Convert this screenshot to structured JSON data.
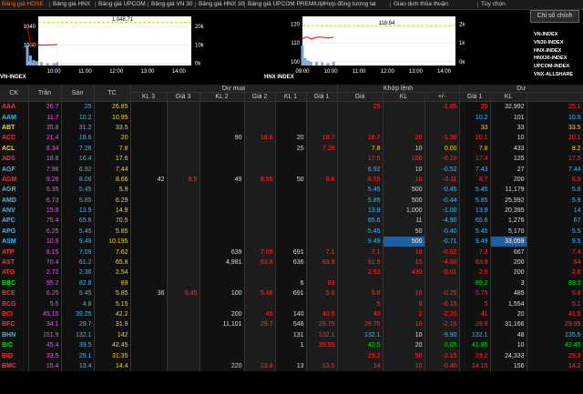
{
  "nav": [
    {
      "label": "Bảng giá HOSE",
      "active": true
    },
    {
      "label": "Bảng giá HNX",
      "active": false
    },
    {
      "label": "Bảng giá UPCOM",
      "active": false
    },
    {
      "label": "Bảng giá VN 30",
      "active": false
    },
    {
      "label": "Bảng giá HNX 30",
      "active": false
    },
    {
      "label": "Bảng giá UPCOM PREMIUM",
      "active": false
    },
    {
      "label": "Hợp đồng tương lai",
      "active": false
    },
    {
      "label": "Giao dịch thỏa thuận",
      "active": false
    },
    {
      "label": "Tùy chọn",
      "active": false
    }
  ],
  "select_button": "Chỉ số chính",
  "chart_data": [
    {
      "type": "line",
      "title": "VN-INDEX",
      "current_label": "1,048.71",
      "x_ticks": [
        "10:00",
        "11:00",
        "12:00",
        "13:00",
        "14:00"
      ],
      "y_left_ticks": [
        "1040",
        "1000",
        "960"
      ],
      "y_right_ticks": [
        "20k",
        "10k",
        "0k"
      ],
      "ylim": [
        955,
        1062
      ],
      "reference": 1048.71,
      "x": [
        9.15,
        9.25,
        9.35,
        9.45,
        9.6,
        9.8,
        10.0,
        10.1
      ],
      "y": [
        1040,
        1004,
        1000,
        1001,
        999,
        1000,
        1000,
        1001
      ],
      "volume": [
        18,
        9,
        5,
        4,
        3,
        2,
        2,
        3
      ]
    },
    {
      "type": "line",
      "title": "HNX INDEX",
      "current_label": "118.94",
      "x_ticks": [
        "09:00",
        "10:00",
        "11:00",
        "12:00",
        "13:00",
        "14:00"
      ],
      "y_left_ticks": [
        "120",
        "110",
        "100"
      ],
      "y_right_ticks": [
        "2k",
        "1k",
        "0k"
      ],
      "ylim": [
        98,
        124
      ],
      "reference": 118.94,
      "x": [
        9.0,
        9.1,
        9.2,
        9.3,
        9.5,
        9.7,
        9.9,
        10.1
      ],
      "y": [
        112,
        113,
        113,
        112,
        113,
        113,
        112.5,
        113
      ],
      "volume": [
        1.6,
        0.6,
        0.4,
        0.3,
        0.3,
        0.25,
        0.2,
        0.3
      ]
    }
  ],
  "index_list": [
    "VN-INDEX",
    "VN30-INDEX",
    "HNX-INDEX",
    "HNX30-INDEX",
    "UPCOM-INDEX",
    "VNX-ALLSHARE"
  ],
  "table": {
    "headers": {
      "ck": "CK",
      "tran": "Trần",
      "san": "Sàn",
      "tc": "TC",
      "du_mua": "Dư mua",
      "khop_lenh": "Khớp lệnh",
      "du_ban": "Dư",
      "kl3": "KL 3",
      "gia3": "Giá 3",
      "kl2": "KL 2",
      "gia2": "Giá 2",
      "kl1": "KL 1",
      "gia1": "Giá 1",
      "gia": "Giá",
      "kl": "KL",
      "change": "+/-",
      "ban_gia1": "Giá 1",
      "ban_kl1": "KL"
    },
    "rows": [
      {
        "ck": "AAA",
        "tran": "26.7",
        "san": "25",
        "tc": "26.85",
        "kl3": "",
        "gia3": "",
        "kl2": "",
        "gia2": "",
        "kl1": "",
        "gia1": "",
        "gia": "25",
        "kl": "",
        "chg": "-1.85",
        "bg1": "25",
        "bkl1": "32,992",
        "dg": "25.1",
        "c": "dn"
      },
      {
        "ck": "AAM",
        "tran": "11.7",
        "san": "10.2",
        "tc": "10.95",
        "kl3": "",
        "gia3": "",
        "kl2": "",
        "gia2": "",
        "kl1": "",
        "gia1": "",
        "gia": "",
        "kl": "",
        "chg": "",
        "bg1": "10.2",
        "bkl1": "101",
        "dg": "10.5",
        "c": "fl"
      },
      {
        "ck": "ABT",
        "tran": "35.8",
        "san": "31.2",
        "tc": "33.5",
        "kl3": "",
        "gia3": "",
        "kl2": "",
        "gia2": "",
        "kl1": "",
        "gia1": "",
        "gia": "",
        "kl": "",
        "chg": "",
        "bg1": "33",
        "bkl1": "33",
        "dg": "33.5",
        "c": "eq"
      },
      {
        "ck": "ACC",
        "tran": "21.4",
        "san": "18.6",
        "tc": "20",
        "kl3": "",
        "gia3": "",
        "kl2": "90",
        "gia2": "18.6",
        "kl1": "20",
        "gia1": "18.7",
        "gia": "18.7",
        "kl": "20",
        "chg": "-1.30",
        "bg1": "20.1",
        "bkl1": "10",
        "dg": "20.1",
        "c": "dn"
      },
      {
        "ck": "ACL",
        "tran": "8.34",
        "san": "7.26",
        "tc": "7.8",
        "kl3": "",
        "gia3": "",
        "kl2": "",
        "gia2": "",
        "kl1": "25",
        "gia1": "7.26",
        "gia": "7.8",
        "kl": "10",
        "chg": "0.00",
        "bg1": "7.8",
        "bkl1": "433",
        "dg": "8.2",
        "c": "eq"
      },
      {
        "ck": "ADS",
        "tran": "18.8",
        "san": "16.4",
        "tc": "17.6",
        "kl3": "",
        "gia3": "",
        "kl2": "",
        "gia2": "",
        "kl1": "",
        "gia1": "",
        "gia": "17.5",
        "kl": "100",
        "chg": "-0.10",
        "bg1": "17.4",
        "bkl1": "125",
        "dg": "17.5",
        "c": "dn"
      },
      {
        "ck": "AGF",
        "tran": "7.96",
        "san": "6.92",
        "tc": "7.44",
        "kl3": "",
        "gia3": "",
        "kl2": "",
        "gia2": "",
        "kl1": "",
        "gia1": "",
        "gia": "6.92",
        "kl": "10",
        "chg": "-0.52",
        "bg1": "7.43",
        "bkl1": "27",
        "dg": "7.44",
        "c": "fl"
      },
      {
        "ck": "AGM",
        "tran": "9.26",
        "san": "8.06",
        "tc": "8.66",
        "kl3": "42",
        "gia3": "8.5",
        "kl2": "49",
        "gia2": "8.55",
        "kl1": "50",
        "gia1": "8.6",
        "gia": "8.55",
        "kl": "10",
        "chg": "-0.11",
        "bg1": "8.7",
        "bkl1": "200",
        "dg": "8.9",
        "c": "dn"
      },
      {
        "ck": "AGR",
        "tran": "6.35",
        "san": "5.45",
        "tc": "5.9",
        "kl3": "",
        "gia3": "",
        "kl2": "",
        "gia2": "",
        "kl1": "",
        "gia1": "",
        "gia": "5.45",
        "kl": "500",
        "chg": "-0.45",
        "bg1": "5.45",
        "bkl1": "11,179",
        "dg": "5.6",
        "c": "fl"
      },
      {
        "ck": "AMD",
        "tran": "6.73",
        "san": "5.85",
        "tc": "6.29",
        "kl3": "",
        "gia3": "",
        "kl2": "",
        "gia2": "",
        "kl1": "",
        "gia1": "",
        "gia": "5.85",
        "kl": "500",
        "chg": "-0.44",
        "bg1": "5.85",
        "bkl1": "25,992",
        "dg": "5.9",
        "c": "fl"
      },
      {
        "ck": "ANV",
        "tran": "15.9",
        "san": "13.9",
        "tc": "14.9",
        "kl3": "",
        "gia3": "",
        "kl2": "",
        "gia2": "",
        "kl1": "",
        "gia1": "",
        "gia": "13.9",
        "kl": "1,000",
        "chg": "-1.00",
        "bg1": "13.9",
        "bkl1": "20,395",
        "dg": "14",
        "c": "fl"
      },
      {
        "ck": "APC",
        "tran": "75.4",
        "san": "65.6",
        "tc": "70.5",
        "kl3": "",
        "gia3": "",
        "kl2": "",
        "gia2": "",
        "kl1": "",
        "gia1": "",
        "gia": "65.6",
        "kl": "11",
        "chg": "-4.90",
        "bg1": "65.6",
        "bkl1": "1,276",
        "dg": "67",
        "c": "fl"
      },
      {
        "ck": "APG",
        "tran": "6.25",
        "san": "5.45",
        "tc": "5.85",
        "kl3": "",
        "gia3": "",
        "kl2": "",
        "gia2": "",
        "kl1": "",
        "gia1": "",
        "gia": "5.45",
        "kl": "50",
        "chg": "-0.40",
        "bg1": "5.45",
        "bkl1": "5,170",
        "dg": "5.5",
        "c": "fl"
      },
      {
        "ck": "ASM",
        "tran": "10.9",
        "san": "9.49",
        "tc": "10.195",
        "kl3": "",
        "gia3": "",
        "kl2": "",
        "gia2": "",
        "kl1": "",
        "gia1": "",
        "gia": "9.49",
        "kl": "500",
        "chg": "-0.71",
        "bg1": "9.49",
        "bkl1": "33,059",
        "dg": "9.5",
        "c": "fl"
      },
      {
        "ck": "ATP",
        "tran": "8.15",
        "san": "7.09",
        "tc": "7.62",
        "kl3": "",
        "gia3": "",
        "kl2": "639",
        "gia2": "7.09",
        "kl1": "691",
        "gia1": "7.1",
        "gia": "7.1",
        "kl": "10",
        "chg": "-0.52",
        "bg1": "7.3",
        "bkl1": "667",
        "dg": "7.4",
        "c": "dn"
      },
      {
        "ck": "AST",
        "tran": "70.4",
        "san": "61.2",
        "tc": "65.8",
        "kl3": "",
        "gia3": "",
        "kl2": "4,981",
        "gia2": "63.8",
        "kl1": "636",
        "gia1": "63.9",
        "gia": "61.9",
        "kl": "10",
        "chg": "-4.00",
        "bg1": "63.9",
        "bkl1": "200",
        "dg": "64",
        "c": "dn"
      },
      {
        "ck": "ATG",
        "tran": "2.72",
        "san": "2.36",
        "tc": "2.54",
        "kl3": "",
        "gia3": "",
        "kl2": "",
        "gia2": "",
        "kl1": "",
        "gia1": "",
        "gia": "2.53",
        "kl": "430",
        "chg": "-0.01",
        "bg1": "2.5",
        "bkl1": "200",
        "dg": "2.6",
        "c": "dn"
      },
      {
        "ck": "BBC",
        "tran": "95.2",
        "san": "82.8",
        "tc": "89",
        "kl3": "",
        "gia3": "",
        "kl2": "",
        "gia2": "",
        "kl1": "6",
        "gia1": "83",
        "gia": "",
        "kl": "",
        "chg": "",
        "bg1": "89.2",
        "bkl1": "3",
        "dg": "89.3",
        "c": "up"
      },
      {
        "ck": "BCE",
        "tran": "6.25",
        "san": "5.45",
        "tc": "5.85",
        "kl3": "36",
        "gia3": "5.45",
        "kl2": "100",
        "gia2": "5.46",
        "kl1": "691",
        "gia1": "5.6",
        "gia": "5.6",
        "kl": "10",
        "chg": "-0.25",
        "bg1": "5.75",
        "bkl1": "485",
        "dg": "5.8",
        "c": "dn"
      },
      {
        "ck": "BCG",
        "tran": "5.5",
        "san": "4.8",
        "tc": "5.15",
        "kl3": "",
        "gia3": "",
        "kl2": "",
        "gia2": "",
        "kl1": "",
        "gia1": "",
        "gia": "5",
        "kl": "9",
        "chg": "-0.15",
        "bg1": "5",
        "bkl1": "1,554",
        "dg": "5.1",
        "c": "dn"
      },
      {
        "ck": "BCI",
        "tran": "45.15",
        "san": "39.25",
        "tc": "42.2",
        "kl3": "",
        "gia3": "",
        "kl2": "200",
        "gia2": "40",
        "kl1": "140",
        "gia1": "40.5",
        "gia": "40",
        "kl": "2",
        "chg": "-2.20",
        "bg1": "41",
        "bkl1": "20",
        "dg": "41.5",
        "c": "dn"
      },
      {
        "ck": "BFC",
        "tran": "34.1",
        "san": "29.7",
        "tc": "31.9",
        "kl3": "",
        "gia3": "",
        "kl2": "11,101",
        "gia2": "29.7",
        "kl1": "546",
        "gia1": "29.75",
        "gia": "29.75",
        "kl": "10",
        "chg": "-2.15",
        "bg1": "29.9",
        "bkl1": "31,166",
        "dg": "29.95",
        "c": "dn"
      },
      {
        "ck": "BHN",
        "tran": "151.9",
        "san": "132.1",
        "tc": "142",
        "kl3": "",
        "gia3": "",
        "kl2": "",
        "gia2": "",
        "kl1": "131",
        "gia1": "132.1",
        "gia": "132.1",
        "kl": "10",
        "chg": "-9.90",
        "bg1": "132.1",
        "bkl1": "48",
        "dg": "135.5",
        "c": "fl"
      },
      {
        "ck": "BIC",
        "tran": "45.4",
        "san": "39.5",
        "tc": "42.45",
        "kl3": "",
        "gia3": "",
        "kl2": "",
        "gia2": "",
        "kl1": "1",
        "gia1": "39.55",
        "gia": "42.5",
        "kl": "20",
        "chg": "0.05",
        "bg1": "41.95",
        "bkl1": "10",
        "dg": "42.45",
        "c": "up"
      },
      {
        "ck": "BID",
        "tran": "33.5",
        "san": "29.1",
        "tc": "31.35",
        "kl3": "",
        "gia3": "",
        "kl2": "",
        "gia2": "",
        "kl1": "",
        "gia1": "",
        "gia": "29.2",
        "kl": "50",
        "chg": "-2.15",
        "bg1": "29.2",
        "bkl1": "24,333",
        "dg": "29.3",
        "c": "dn"
      },
      {
        "ck": "BMC",
        "tran": "15.4",
        "san": "13.4",
        "tc": "14.4",
        "kl3": "",
        "gia3": "",
        "kl2": "220",
        "gia2": "13.4",
        "kl1": "13",
        "gia1": "13.5",
        "gia": "14",
        "kl": "10",
        "chg": "-0.40",
        "bg1": "14.15",
        "bkl1": "156",
        "dg": "14.2",
        "c": "dn"
      }
    ]
  }
}
